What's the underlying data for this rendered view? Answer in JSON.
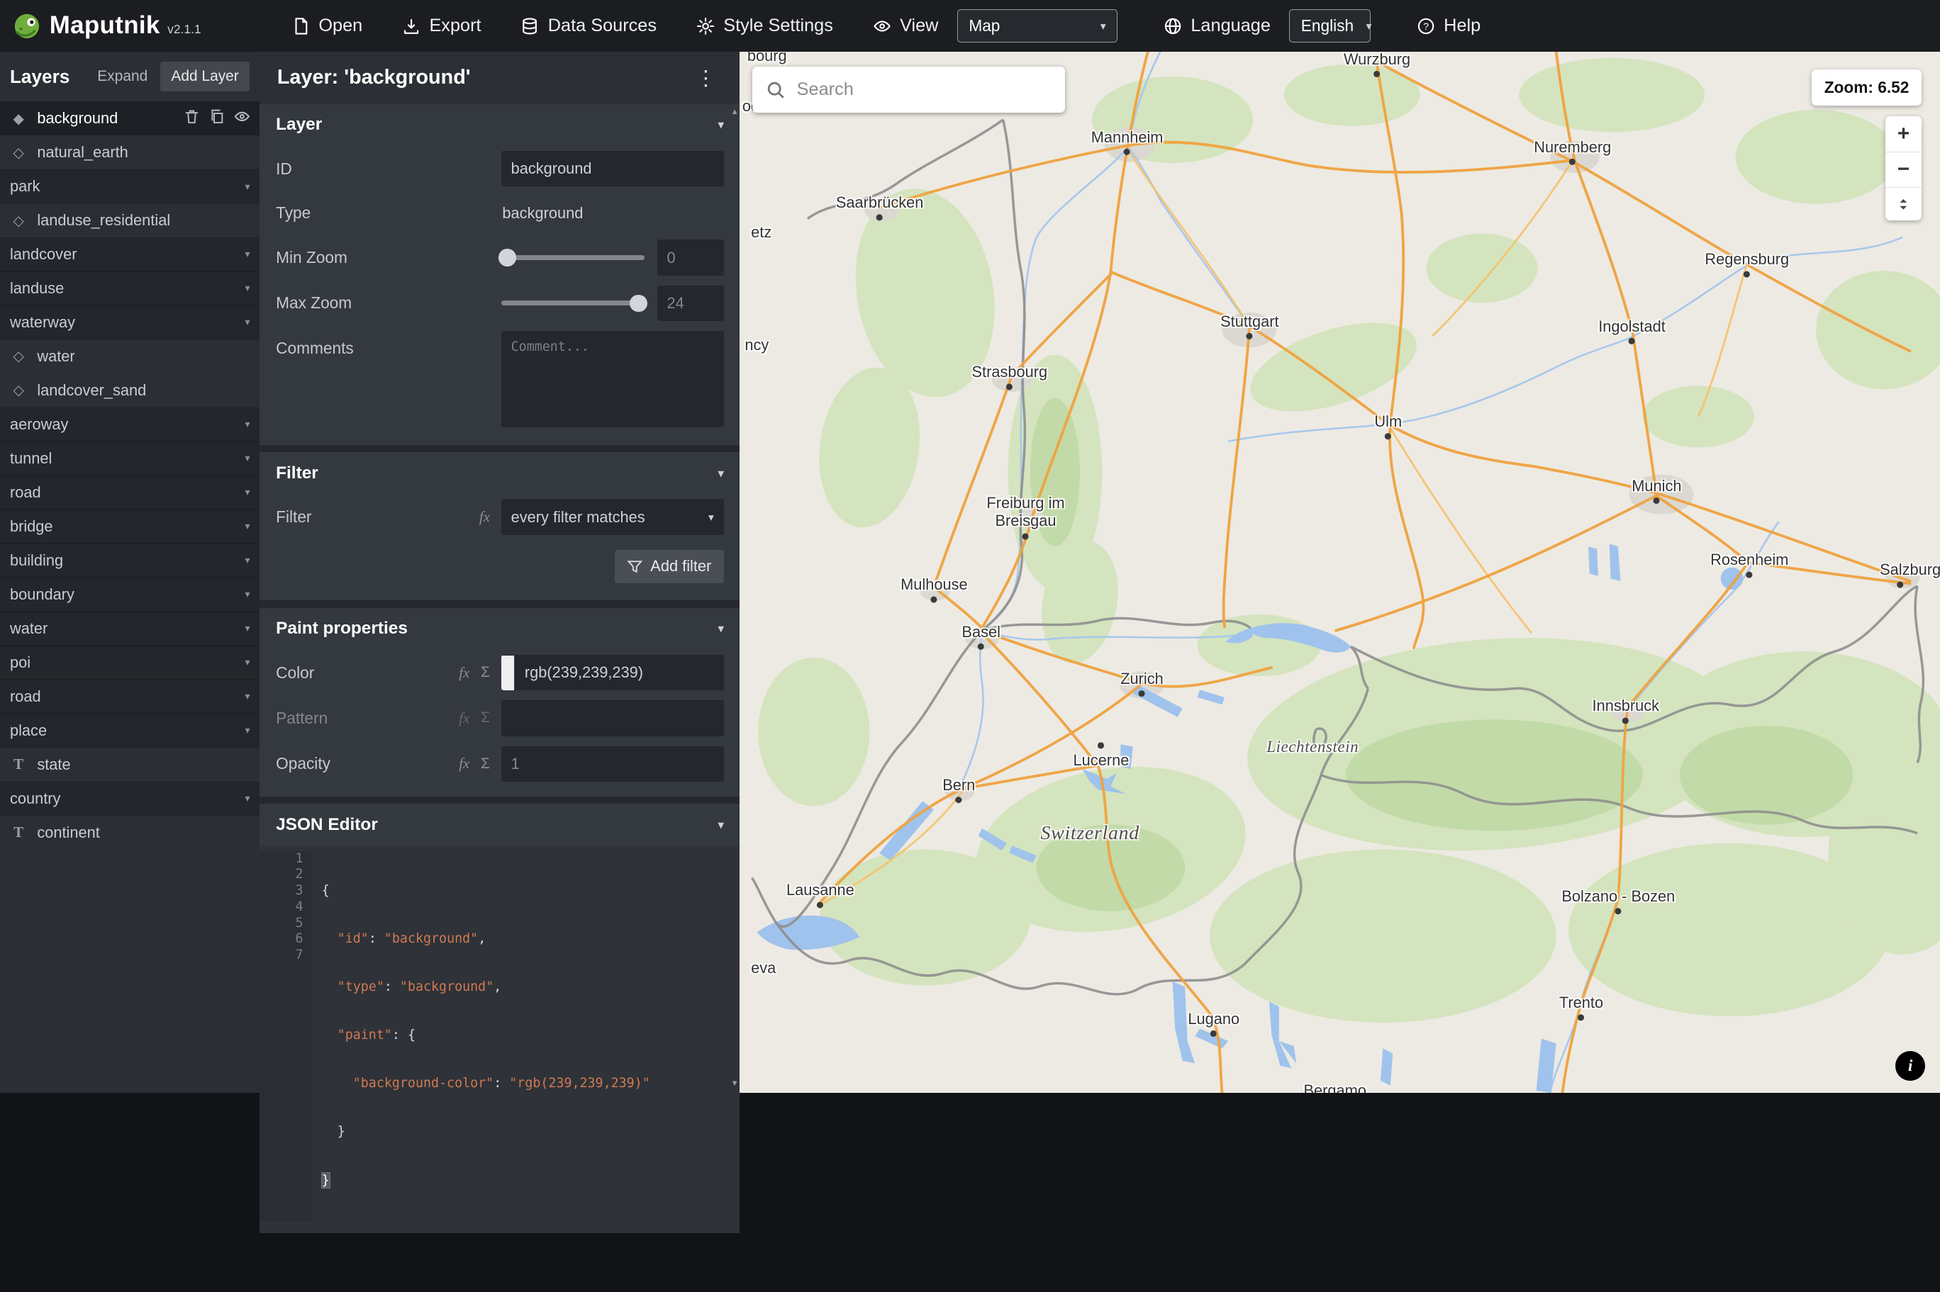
{
  "toolbar": {
    "app_name": "Maputnik",
    "version": "v2.1.1",
    "open": "Open",
    "export": "Export",
    "data_sources": "Data Sources",
    "style_settings": "Style Settings",
    "view": "View",
    "view_value": "Map",
    "language": "Language",
    "language_value": "English",
    "help": "Help"
  },
  "layers_panel": {
    "title": "Layers",
    "expand_button": "Expand",
    "add_layer_button": "Add Layer",
    "items": [
      "background",
      "natural_earth",
      "park",
      "landuse_residential",
      "landcover",
      "landuse",
      "waterway",
      "water",
      "landcover_sand",
      "aeroway",
      "tunnel",
      "road",
      "bridge",
      "building",
      "boundary",
      "water",
      "poi",
      "road",
      "place",
      "state",
      "country",
      "continent"
    ]
  },
  "editor": {
    "header": "Layer: 'background'",
    "layer_section": {
      "title": "Layer",
      "id_label": "ID",
      "id_value": "background",
      "type_label": "Type",
      "type_value": "background",
      "min_zoom_label": "Min Zoom",
      "min_zoom_value": "0",
      "max_zoom_label": "Max Zoom",
      "max_zoom_value": "24",
      "comments_label": "Comments",
      "comments_placeholder": "Comment..."
    },
    "filter_section": {
      "title": "Filter",
      "filter_label": "Filter",
      "combiner_value": "every filter matches",
      "add_filter_button": "Add filter"
    },
    "paint_section": {
      "title": "Paint properties",
      "color_label": "Color",
      "color_value": "rgb(239,239,239)",
      "color_swatch": "#efefef",
      "pattern_label": "Pattern",
      "opacity_label": "Opacity",
      "opacity_placeholder": "1"
    },
    "json_section": {
      "title": "JSON Editor",
      "line_numbers": [
        "1",
        "2",
        "3",
        "4",
        "5",
        "6",
        "7"
      ],
      "lines": [
        [
          "{"
        ],
        [
          "  \"id\"",
          ": ",
          "\"background\"",
          ","
        ],
        [
          "  \"type\"",
          ": ",
          "\"background\"",
          ","
        ],
        [
          "  \"paint\"",
          ": ",
          "{"
        ],
        [
          "    \"background-color\"",
          ": ",
          "\"rgb(239,239,239)\""
        ],
        [
          "  }"
        ],
        [
          "}"
        ]
      ]
    }
  },
  "map": {
    "search_placeholder": "Search",
    "zoom_indicator": "Zoom: 6.52",
    "cities": [
      "Wurzburg",
      "Mannheim",
      "Nuremberg",
      "Saarbrücken",
      "Regensburg",
      "Stuttgart",
      "Ingolstadt",
      "Strasbourg",
      "Ulm",
      "Munich",
      "Freiburg im Breisgau",
      "Rosenheim",
      "Salzburg",
      "Mulhouse",
      "Basel",
      "Zurich",
      "Innsbruck",
      "Lucerne",
      "Bern",
      "Lausanne",
      "Bolzano - Bozen",
      "Trento",
      "Lugano",
      "Bergamo"
    ],
    "regions": [
      "Liechtenstein",
      "Switzerland"
    ],
    "partial_labels": [
      "bourg",
      "oc",
      "etz",
      "ncy",
      "eva"
    ]
  },
  "icons": {
    "help": "?",
    "kebab": "⋮",
    "caret": "▾",
    "fx": "fx",
    "sigma": "Σ",
    "diamond": "◇",
    "diamond_filled": "◆",
    "text_layer": "T",
    "zoom_in": "+",
    "zoom_out": "−",
    "info": "i",
    "scroll_up": "▲",
    "scroll_down": "▼"
  },
  "colors": {
    "brand_green": "#6fae3d",
    "map_land": "#edeae3",
    "map_green": "#cfe3b8",
    "map_water": "#9fc3ec",
    "map_road": "#f0a23e",
    "background_color_value": "#efefef"
  }
}
